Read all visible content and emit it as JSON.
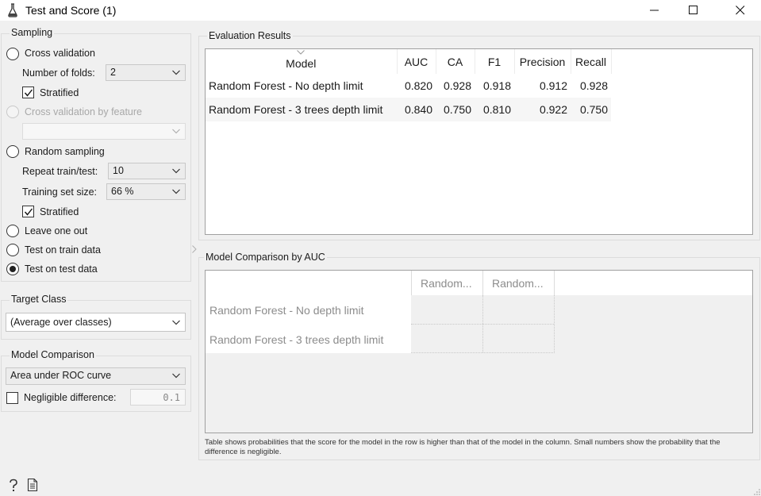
{
  "window": {
    "title": "Test and Score (1)",
    "icons": {
      "app": "flask-icon",
      "minimize": "minimize-icon",
      "maximize": "maximize-icon",
      "close": "close-icon"
    }
  },
  "sampling": {
    "group_title": "Sampling",
    "cross_validation": "Cross validation",
    "folds_label": "Number of folds:",
    "folds_value": "2",
    "stratified_1": "Stratified",
    "cv_by_feature": "Cross validation by feature",
    "random_sampling": "Random sampling",
    "repeat_label": "Repeat train/test:",
    "repeat_value": "10",
    "train_size_label": "Training set size:",
    "train_size_value": "66 %",
    "stratified_2": "Stratified",
    "leave_one_out": "Leave one out",
    "test_on_train": "Test on train data",
    "test_on_test": "Test on test data",
    "selected": "Test on test data"
  },
  "target_class": {
    "group_title": "Target Class",
    "value": "(Average over classes)"
  },
  "model_comparison": {
    "group_title": "Model Comparison",
    "value": "Area under ROC curve",
    "negligible_label": "Negligible difference:",
    "negligible_value": "0.1"
  },
  "evaluation": {
    "group_title": "Evaluation Results",
    "columns": [
      "Model",
      "AUC",
      "CA",
      "F1",
      "Precision",
      "Recall"
    ],
    "rows": [
      [
        "Random Forest - No depth limit",
        "0.820",
        "0.928",
        "0.918",
        "0.912",
        "0.928"
      ],
      [
        "Random Forest - 3 trees depth limit",
        "0.840",
        "0.750",
        "0.810",
        "0.922",
        "0.750"
      ]
    ]
  },
  "comparison": {
    "group_title": "Model Comparison by AUC",
    "col_headers": [
      "Random...",
      "Random..."
    ],
    "row_labels": [
      "Random Forest - No depth limit",
      "Random Forest - 3 trees depth limit"
    ],
    "footnote": "Table shows probabilities that the score for the model in the row is higher than that of the model in the column. Small numbers show the probability that the difference is negligible."
  },
  "status_icons": [
    "help-icon",
    "report-icon"
  ]
}
